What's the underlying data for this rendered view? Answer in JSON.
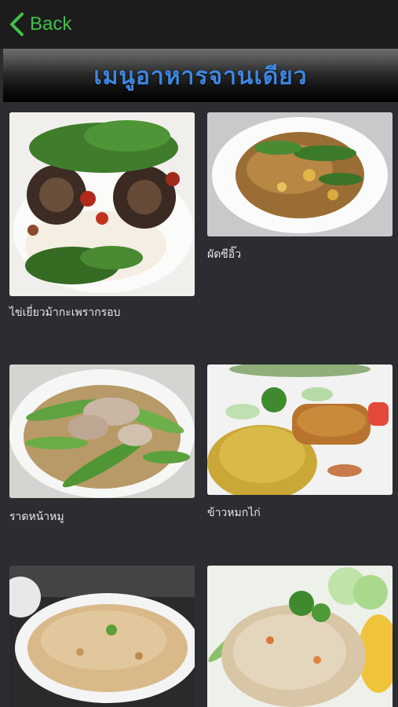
{
  "nav": {
    "back_label": "Back",
    "back_icon": "chevron-left-icon",
    "accent": "#3fc14a"
  },
  "header": {
    "title": "เมนูอาหารจานเดียว",
    "title_color": "#3f86e0"
  },
  "menu": {
    "items": [
      {
        "name": "ไข่เยี่ยวม้ากะเพรากรอบ"
      },
      {
        "name": "ผัดซีอิ๊ว"
      },
      {
        "name": "ราดหน้าหมู"
      },
      {
        "name": "ข้าวหมกไก่"
      },
      {
        "name": ""
      },
      {
        "name": ""
      }
    ]
  }
}
